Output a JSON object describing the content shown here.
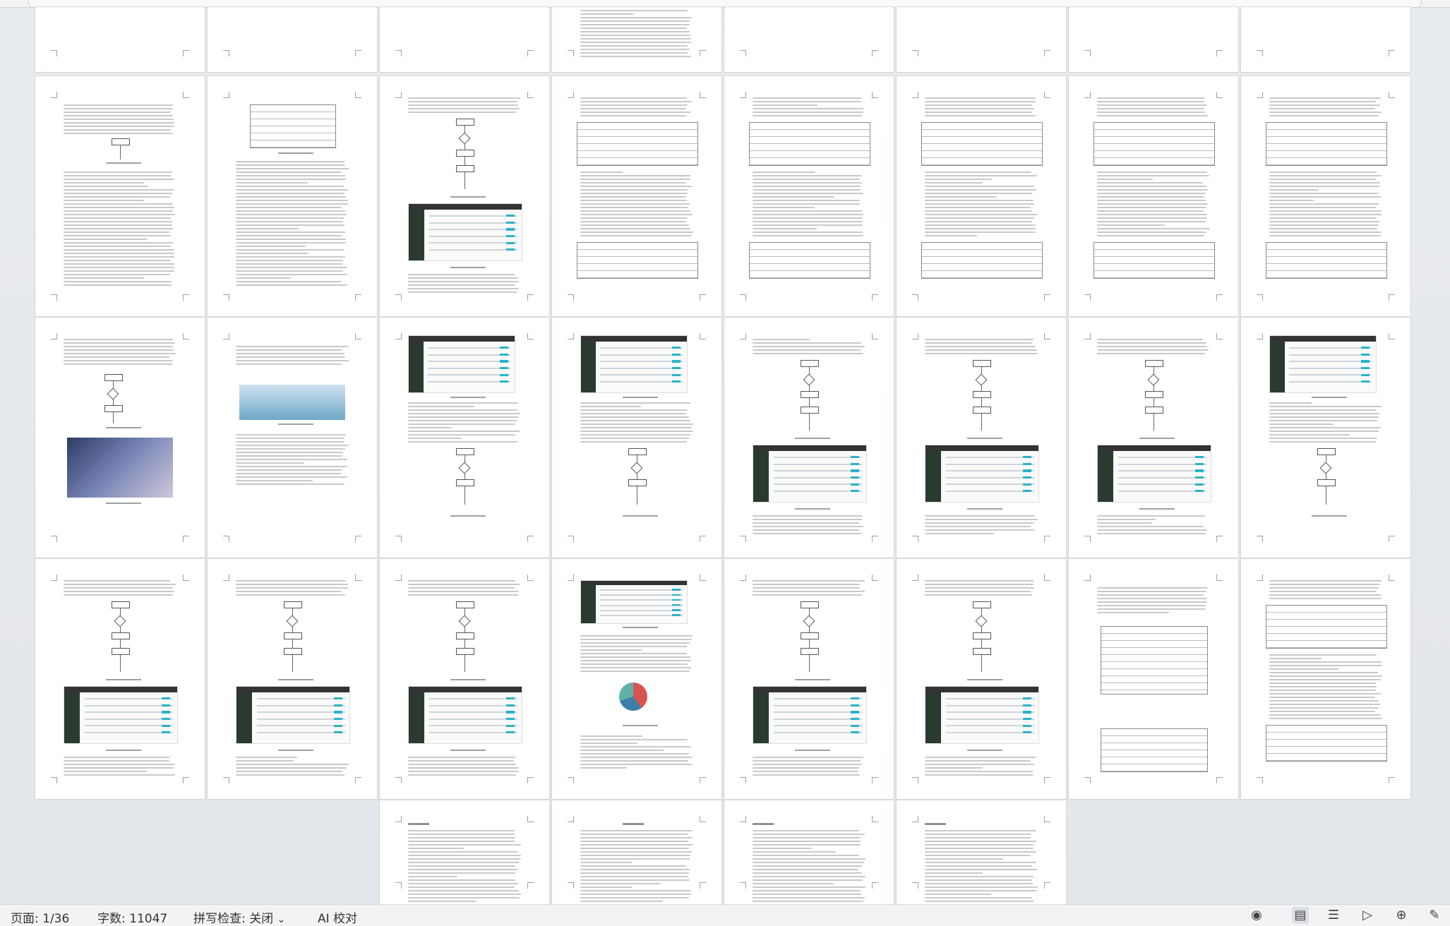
{
  "status_bar": {
    "page_indicator": "页面: 1/36",
    "word_count": "字数: 11047",
    "spell_check": "拼写检查: 关闭",
    "spell_check_arrow": "⌄",
    "ai_proofread": "AI 校对"
  },
  "view_icons": [
    {
      "name": "eye-icon",
      "glyph": "◉"
    },
    {
      "name": "page-view-icon",
      "glyph": "▤"
    },
    {
      "name": "outline-view-icon",
      "glyph": "☰"
    },
    {
      "name": "play-icon",
      "glyph": "▷"
    },
    {
      "name": "web-view-icon",
      "glyph": "⊕"
    },
    {
      "name": "pen-icon",
      "glyph": "✎"
    }
  ],
  "accent_color": "#2bb3c9",
  "document": {
    "page_count": 36,
    "current_page": 1
  }
}
